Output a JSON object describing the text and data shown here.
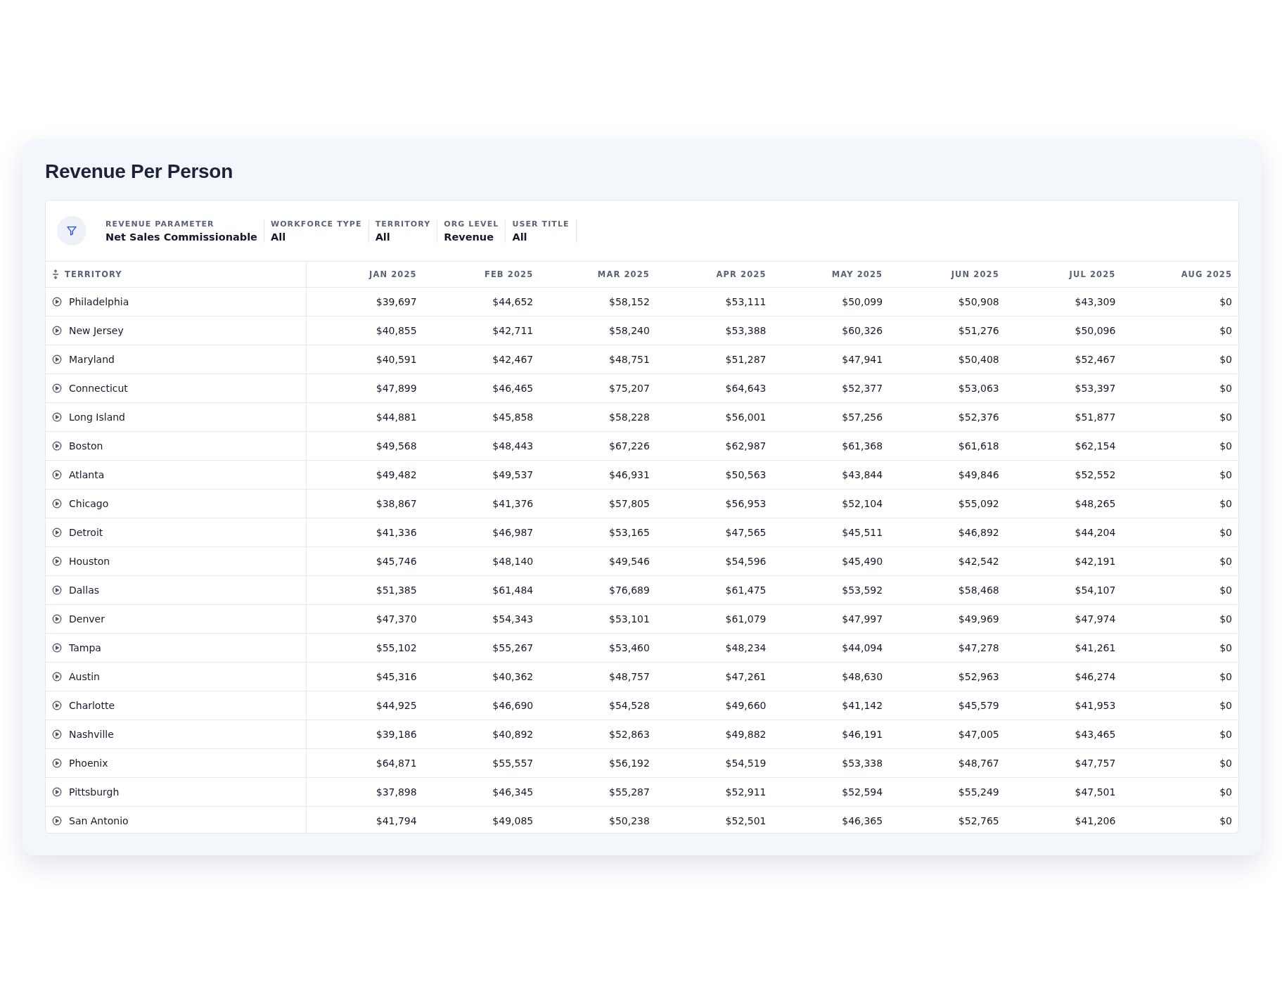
{
  "title": "Revenue Per Person",
  "filters": [
    {
      "label": "REVENUE PARAMETER",
      "value": "Net Sales Commissionable"
    },
    {
      "label": "WORKFORCE TYPE",
      "value": "All"
    },
    {
      "label": "TERRITORY",
      "value": "All"
    },
    {
      "label": "ORG LEVEL",
      "value": "Revenue"
    },
    {
      "label": "USER TITLE",
      "value": "All"
    }
  ],
  "table": {
    "columns": [
      "TERRITORY",
      "JAN 2025",
      "FEB 2025",
      "MAR 2025",
      "APR 2025",
      "MAY 2025",
      "JUN 2025",
      "JUL 2025",
      "AUG 2025"
    ],
    "rows": [
      {
        "territory": "Philadelphia",
        "values": [
          "$39,697",
          "$44,652",
          "$58,152",
          "$53,111",
          "$50,099",
          "$50,908",
          "$43,309",
          "$0"
        ]
      },
      {
        "territory": "New Jersey",
        "values": [
          "$40,855",
          "$42,711",
          "$58,240",
          "$53,388",
          "$60,326",
          "$51,276",
          "$50,096",
          "$0"
        ]
      },
      {
        "territory": "Maryland",
        "values": [
          "$40,591",
          "$42,467",
          "$48,751",
          "$51,287",
          "$47,941",
          "$50,408",
          "$52,467",
          "$0"
        ]
      },
      {
        "territory": "Connecticut",
        "values": [
          "$47,899",
          "$46,465",
          "$75,207",
          "$64,643",
          "$52,377",
          "$53,063",
          "$53,397",
          "$0"
        ]
      },
      {
        "territory": "Long Island",
        "values": [
          "$44,881",
          "$45,858",
          "$58,228",
          "$56,001",
          "$57,256",
          "$52,376",
          "$51,877",
          "$0"
        ]
      },
      {
        "territory": "Boston",
        "values": [
          "$49,568",
          "$48,443",
          "$67,226",
          "$62,987",
          "$61,368",
          "$61,618",
          "$62,154",
          "$0"
        ]
      },
      {
        "territory": "Atlanta",
        "values": [
          "$49,482",
          "$49,537",
          "$46,931",
          "$50,563",
          "$43,844",
          "$49,846",
          "$52,552",
          "$0"
        ]
      },
      {
        "territory": "Chicago",
        "values": [
          "$38,867",
          "$41,376",
          "$57,805",
          "$56,953",
          "$52,104",
          "$55,092",
          "$48,265",
          "$0"
        ]
      },
      {
        "territory": "Detroit",
        "values": [
          "$41,336",
          "$46,987",
          "$53,165",
          "$47,565",
          "$45,511",
          "$46,892",
          "$44,204",
          "$0"
        ]
      },
      {
        "territory": "Houston",
        "values": [
          "$45,746",
          "$48,140",
          "$49,546",
          "$54,596",
          "$45,490",
          "$42,542",
          "$42,191",
          "$0"
        ]
      },
      {
        "territory": "Dallas",
        "values": [
          "$51,385",
          "$61,484",
          "$76,689",
          "$61,475",
          "$53,592",
          "$58,468",
          "$54,107",
          "$0"
        ]
      },
      {
        "territory": "Denver",
        "values": [
          "$47,370",
          "$54,343",
          "$53,101",
          "$61,079",
          "$47,997",
          "$49,969",
          "$47,974",
          "$0"
        ]
      },
      {
        "territory": "Tampa",
        "values": [
          "$55,102",
          "$55,267",
          "$53,460",
          "$48,234",
          "$44,094",
          "$47,278",
          "$41,261",
          "$0"
        ]
      },
      {
        "territory": "Austin",
        "values": [
          "$45,316",
          "$40,362",
          "$48,757",
          "$47,261",
          "$48,630",
          "$52,963",
          "$46,274",
          "$0"
        ]
      },
      {
        "territory": "Charlotte",
        "values": [
          "$44,925",
          "$46,690",
          "$54,528",
          "$49,660",
          "$41,142",
          "$45,579",
          "$41,953",
          "$0"
        ]
      },
      {
        "territory": "Nashville",
        "values": [
          "$39,186",
          "$40,892",
          "$52,863",
          "$49,882",
          "$46,191",
          "$47,005",
          "$43,465",
          "$0"
        ]
      },
      {
        "territory": "Phoenix",
        "values": [
          "$64,871",
          "$55,557",
          "$56,192",
          "$54,519",
          "$53,338",
          "$48,767",
          "$47,757",
          "$0"
        ]
      },
      {
        "territory": "Pittsburgh",
        "values": [
          "$37,898",
          "$46,345",
          "$55,287",
          "$52,911",
          "$52,594",
          "$55,249",
          "$47,501",
          "$0"
        ]
      },
      {
        "territory": "San Antonio",
        "values": [
          "$41,794",
          "$49,085",
          "$50,238",
          "$52,501",
          "$46,365",
          "$52,765",
          "$41,206",
          "$0"
        ]
      }
    ]
  }
}
